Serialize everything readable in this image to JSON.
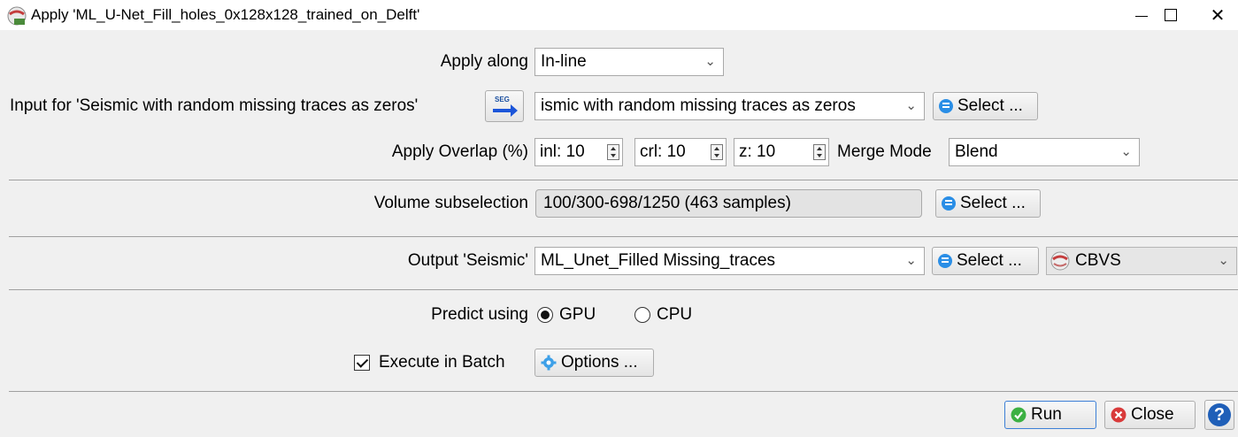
{
  "window": {
    "title": "Apply 'ML_U-Net_Fill_holes_0x128x128_trained_on_Delft'",
    "minimize_glyph": "minimize-icon",
    "maximize_glyph": "maximize-icon",
    "close_glyph": "✕"
  },
  "apply_along": {
    "label": "Apply along",
    "value": "In-line"
  },
  "input": {
    "label": "Input for 'Seismic with random missing traces as zeros'",
    "value": "ismic with random missing traces as zeros",
    "import_icon_text": "SEG",
    "select_label": "Select ..."
  },
  "overlap": {
    "label": "Apply Overlap (%)",
    "inl": "inl: 10",
    "crl": "crl: 10",
    "z": "z: 10",
    "merge_label": "Merge Mode",
    "merge_value": "Blend"
  },
  "volume": {
    "label": "Volume subselection",
    "value": "100/300-698/1250 (463 samples)",
    "select_label": "Select ..."
  },
  "output": {
    "label": "Output 'Seismic'",
    "value": "ML_Unet_Filled Missing_traces",
    "select_label": "Select ...",
    "format_value": "CBVS"
  },
  "predict": {
    "label": "Predict using",
    "gpu_label": "GPU",
    "cpu_label": "CPU",
    "selected": "GPU"
  },
  "batch": {
    "label": "Execute in Batch",
    "checked": true,
    "options_label": "Options ..."
  },
  "footer": {
    "run_label": "Run",
    "close_label": "Close",
    "help_glyph": "?"
  },
  "colors": {
    "window_bg": "#f0f0f0",
    "select_icon": "#2a8ee6",
    "run_icon": "#3cb043",
    "close_icon": "#d93a3a",
    "help_icon": "#1f5fb8"
  }
}
